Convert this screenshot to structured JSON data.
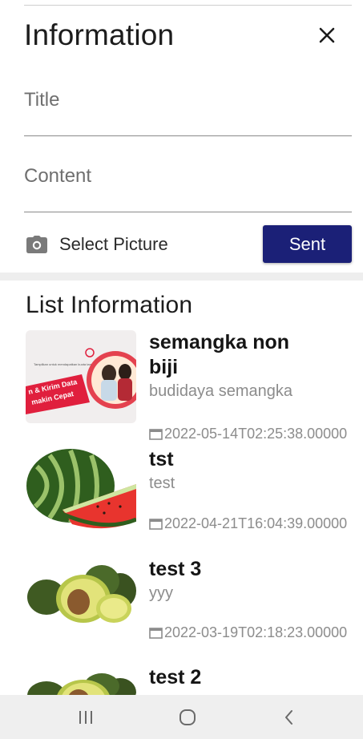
{
  "header": {
    "title": "Information"
  },
  "form": {
    "title_placeholder": "Title",
    "content_placeholder": "Content",
    "select_picture_label": "Select Picture",
    "submit_label": "Sent"
  },
  "list": {
    "heading": "List Information",
    "items": [
      {
        "title": "semangka non biji",
        "subtitle": "budidaya semangka",
        "date": "2022-05-14T02:25:38.00000"
      },
      {
        "title": "tst",
        "subtitle": "test",
        "date": "2022-04-21T16:04:39.00000"
      },
      {
        "title": "test 3",
        "subtitle": "yyy",
        "date": "2022-03-19T02:18:23.00000"
      },
      {
        "title": "test 2",
        "subtitle": "",
        "date": ""
      }
    ]
  },
  "thumbnail_texts": {
    "banner_caption": "Tampilkan untuk mendapatkan kuota tambahan",
    "banner_headline_1": "n & Kirim Data",
    "banner_headline_2": "makin Cepat"
  },
  "colors": {
    "accent": "#1b2077",
    "background": "#ffffff",
    "divider": "#8a8a8a",
    "muted_text": "#8c8c8c",
    "navbar": "#efefef"
  },
  "icons": {
    "close": "close-icon",
    "camera": "camera-icon",
    "calendar": "calendar-icon",
    "nav_recents": "recents-icon",
    "nav_home": "home-icon",
    "nav_back": "back-icon"
  }
}
